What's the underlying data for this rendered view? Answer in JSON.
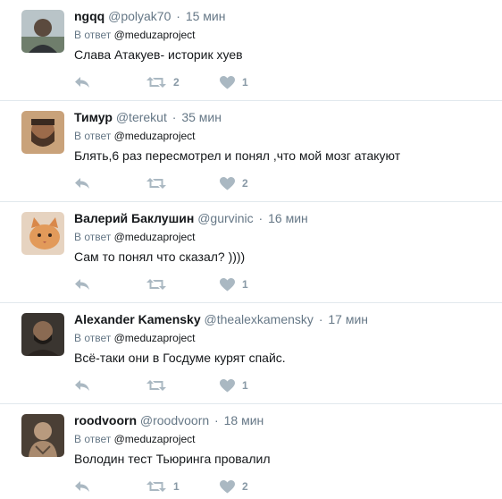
{
  "colors": {
    "icon": "#aab8c2",
    "meta": "#657786",
    "text": "#14171a",
    "divider": "#e1e8ed"
  },
  "tweets": [
    {
      "name": "ngqq",
      "handle": "@polyak70",
      "time": "15 мин",
      "reply_prefix": "В ответ",
      "reply_to": "@meduzaproject",
      "text": "Слава Атакуев- историк хуев",
      "retweets": "2",
      "likes": "1",
      "avatar_icon": "user-avatar-icon"
    },
    {
      "name": "Тимур",
      "handle": "@terekut",
      "time": "35 мин",
      "reply_prefix": "В ответ",
      "reply_to": "@meduzaproject",
      "text": "Блять,6 раз пересмотрел и понял ,что мой мозг атакуют",
      "retweets": "",
      "likes": "2",
      "avatar_icon": "user-avatar-icon"
    },
    {
      "name": "Валерий Баклушин",
      "handle": "@gurvinic",
      "time": "16 мин",
      "reply_prefix": "В ответ",
      "reply_to": "@meduzaproject",
      "text": "Сам то понял что сказал? ))))",
      "retweets": "",
      "likes": "1",
      "avatar_icon": "cat-avatar-icon"
    },
    {
      "name": "Alexander Kamensky",
      "handle": "@thealexkamensky",
      "time": "17 мин",
      "reply_prefix": "В ответ",
      "reply_to": "@meduzaproject",
      "text": "Всё-таки они в Госдуме курят спайс.",
      "retweets": "",
      "likes": "1",
      "avatar_icon": "user-avatar-icon"
    },
    {
      "name": "roodvoorn",
      "handle": "@roodvoorn",
      "time": "18 мин",
      "reply_prefix": "В ответ",
      "reply_to": "@meduzaproject",
      "text": "Володин тест Тьюринга провалил",
      "retweets": "1",
      "likes": "2",
      "avatar_icon": "user-avatar-icon"
    }
  ]
}
